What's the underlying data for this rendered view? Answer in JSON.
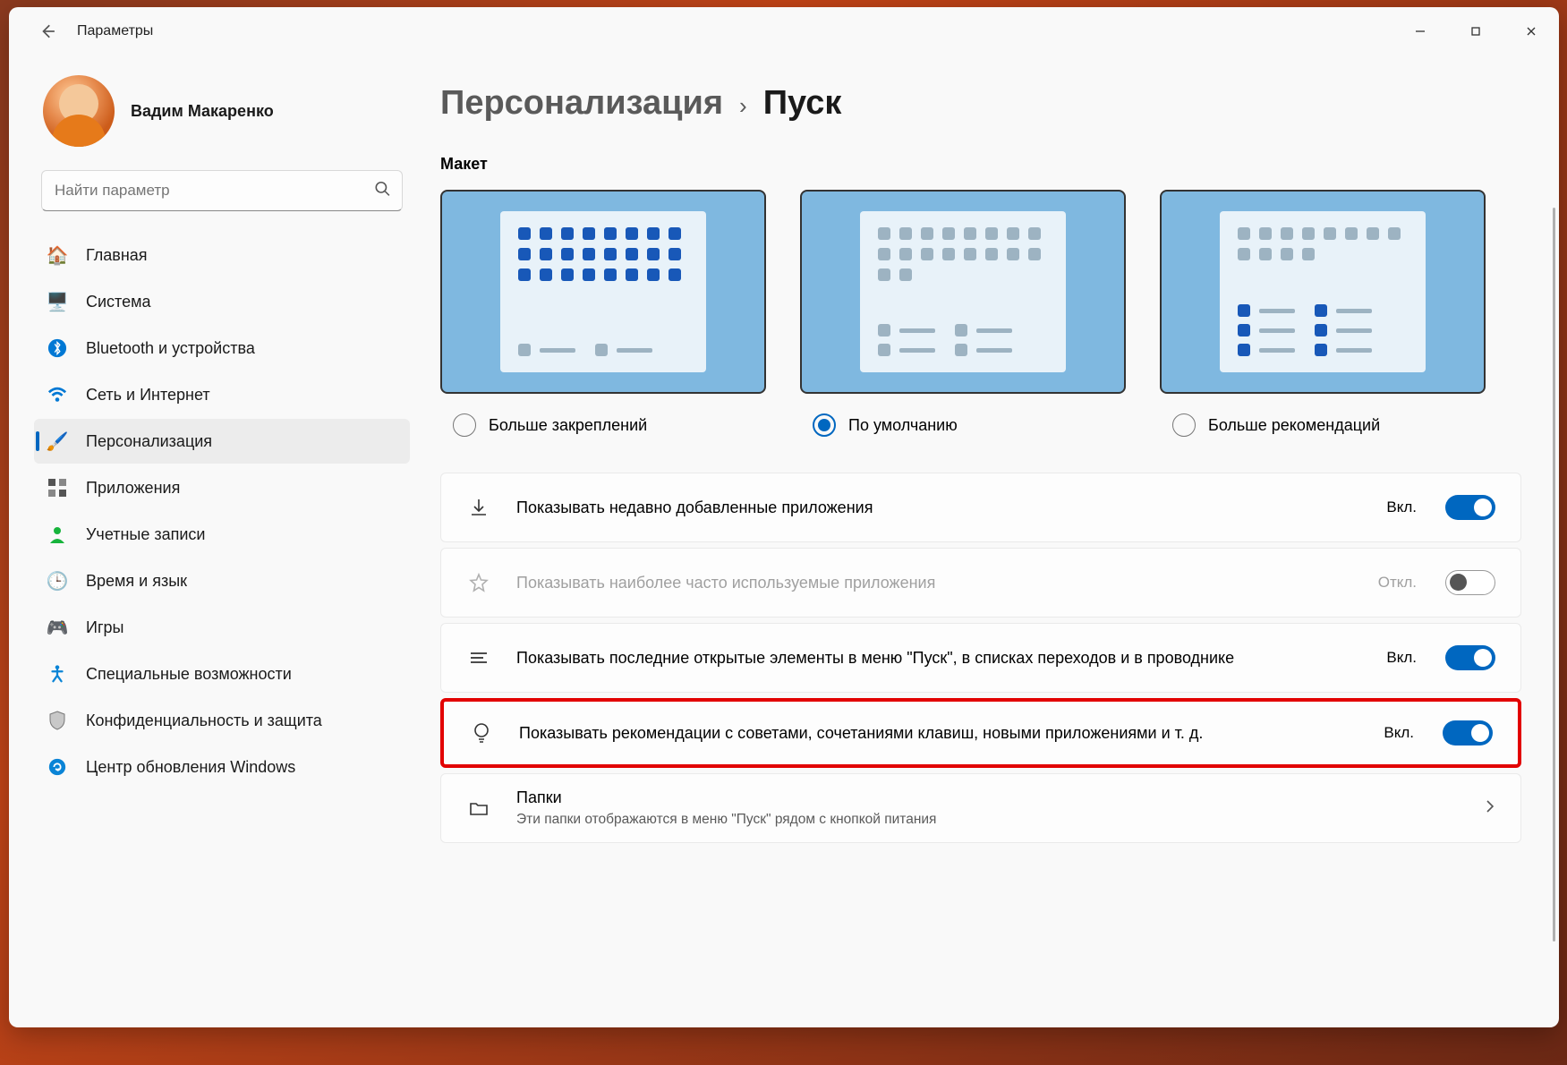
{
  "app_title": "Параметры",
  "profile": {
    "name": "Вадим Макаренко"
  },
  "search": {
    "placeholder": "Найти параметр"
  },
  "sidebar": {
    "items": [
      {
        "label": "Главная"
      },
      {
        "label": "Система"
      },
      {
        "label": "Bluetooth и устройства"
      },
      {
        "label": "Сеть и Интернет"
      },
      {
        "label": "Персонализация"
      },
      {
        "label": "Приложения"
      },
      {
        "label": "Учетные записи"
      },
      {
        "label": "Время и язык"
      },
      {
        "label": "Игры"
      },
      {
        "label": "Специальные возможности"
      },
      {
        "label": "Конфиденциальность и защита"
      },
      {
        "label": "Центр обновления Windows"
      }
    ]
  },
  "breadcrumb": {
    "parent": "Персонализация",
    "current": "Пуск"
  },
  "layout_section": {
    "title": "Макет",
    "options": [
      {
        "label": "Больше закреплений"
      },
      {
        "label": "По умолчанию"
      },
      {
        "label": "Больше рекомендаций"
      }
    ]
  },
  "settings": [
    {
      "label": "Показывать недавно добавленные приложения",
      "state": "Вкл."
    },
    {
      "label": "Показывать наиболее часто используемые приложения",
      "state": "Откл."
    },
    {
      "label": "Показывать последние открытые элементы в меню \"Пуск\", в списках переходов и в проводнике",
      "state": "Вкл."
    },
    {
      "label": "Показывать рекомендации с советами, сочетаниями клавиш, новыми приложениями и т. д.",
      "state": "Вкл."
    },
    {
      "label": "Папки",
      "sub": "Эти папки отображаются в меню \"Пуск\" рядом с кнопкой питания"
    }
  ]
}
